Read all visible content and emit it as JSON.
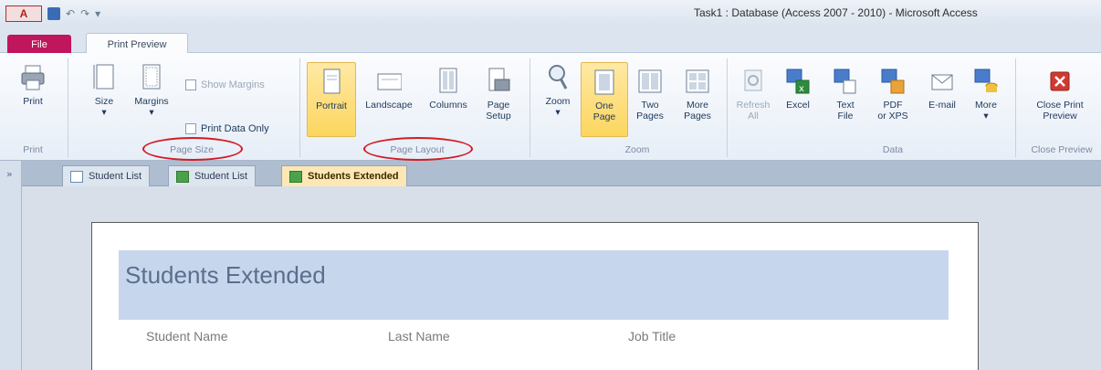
{
  "window": {
    "title": "Task1 : Database (Access 2007 - 2010) - Microsoft Access",
    "app_logo": "A"
  },
  "tabs": {
    "file": "File",
    "print_preview": "Print Preview"
  },
  "ribbon": {
    "print": {
      "label": "Print",
      "group": "Print"
    },
    "page_size": {
      "size": "Size",
      "margins": "Margins",
      "show_margins": "Show Margins",
      "print_data_only": "Print Data Only",
      "group": "Page Size"
    },
    "page_layout": {
      "portrait": "Portrait",
      "landscape": "Landscape",
      "columns": "Columns",
      "page_setup_1": "Page",
      "page_setup_2": "Setup",
      "group": "Page Layout"
    },
    "zoom": {
      "zoom": "Zoom",
      "one_page_1": "One",
      "one_page_2": "Page",
      "two_pages_1": "Two",
      "two_pages_2": "Pages",
      "more_pages_1": "More",
      "more_pages_2": "Pages",
      "group": "Zoom"
    },
    "data": {
      "refresh_1": "Refresh",
      "refresh_2": "All",
      "excel": "Excel",
      "text_file_1": "Text",
      "text_file_2": "File",
      "pdf_1": "PDF",
      "pdf_2": "or XPS",
      "email": "E-mail",
      "more": "More",
      "group": "Data"
    },
    "close": {
      "label_1": "Close Print",
      "label_2": "Preview",
      "group": "Close Preview"
    }
  },
  "doc_tabs": [
    {
      "label": "Student List"
    },
    {
      "label": "Student List"
    },
    {
      "label": "Students Extended"
    }
  ],
  "report": {
    "title": "Students Extended",
    "columns": [
      "Student Name",
      "Last Name",
      "Job Title"
    ]
  }
}
